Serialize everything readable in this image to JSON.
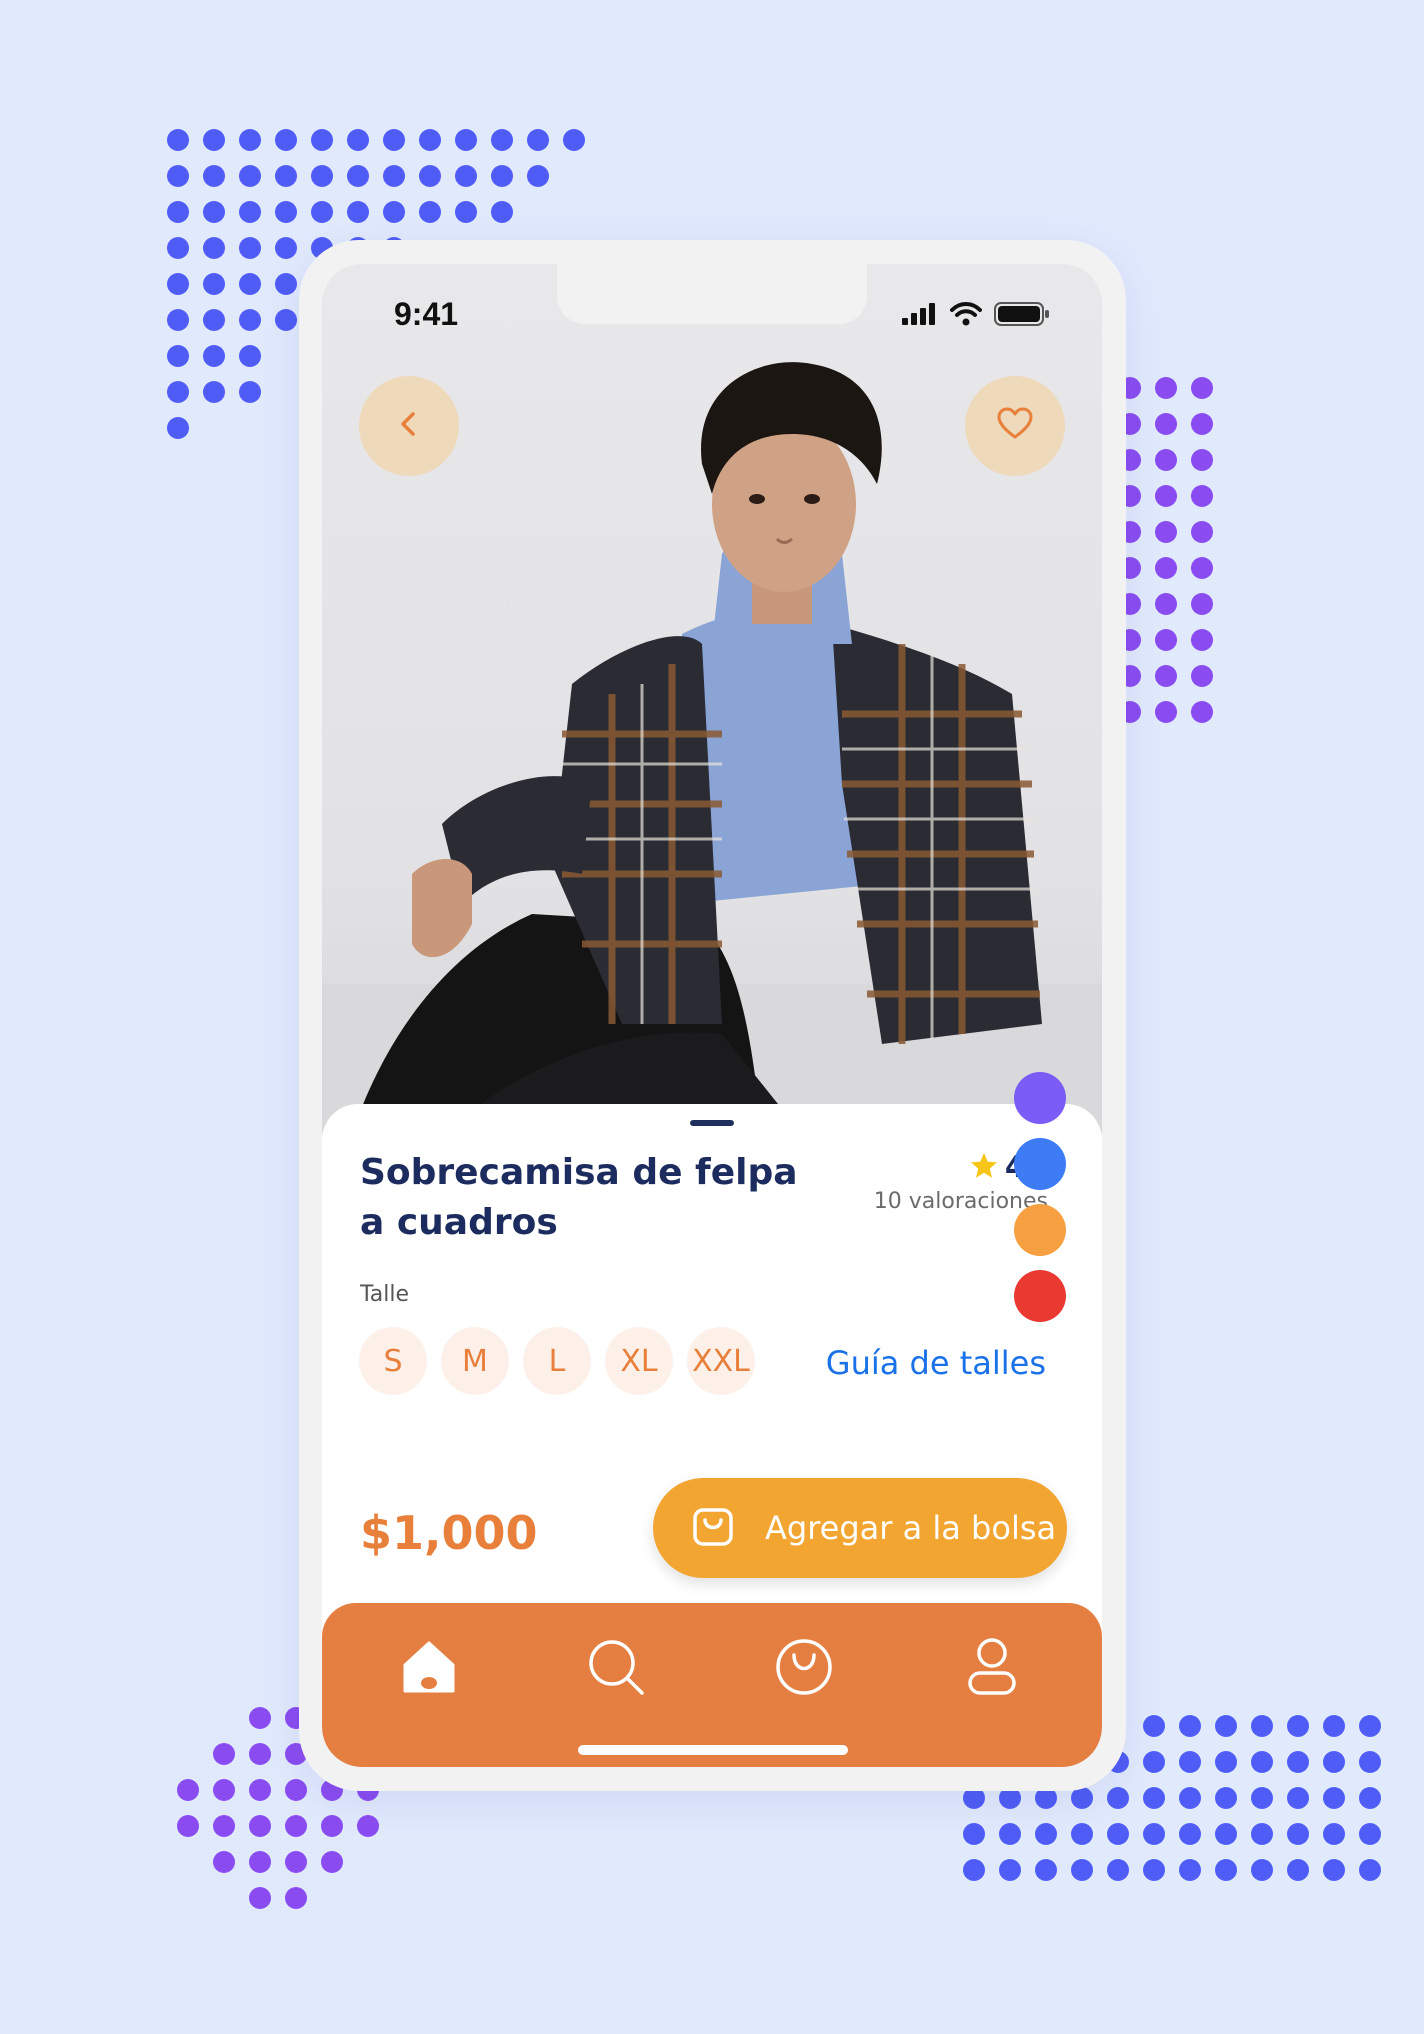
{
  "status_bar": {
    "time": "9:41",
    "signal_icon": "cellular-signal-icon",
    "wifi_icon": "wifi-icon",
    "battery_icon": "battery-icon"
  },
  "header": {
    "back_icon": "chevron-left-icon",
    "favorite_icon": "heart-icon"
  },
  "color_swatches": [
    {
      "name": "purple",
      "color": "#7b5cf6"
    },
    {
      "name": "blue",
      "color": "#3d7cf5"
    },
    {
      "name": "orange",
      "color": "#f7a041"
    },
    {
      "name": "red",
      "color": "#e83a30"
    }
  ],
  "product": {
    "title": "Sobrecamisa de felpa a cuadros",
    "rating": "4.5",
    "rating_icon": "star-icon",
    "rating_count": "10 valoraciones",
    "size_label": "Talle",
    "sizes": [
      "S",
      "M",
      "L",
      "XL",
      "XXL"
    ],
    "size_guide": "Guía de talles",
    "price": "$1,000"
  },
  "cart_button": {
    "label": "Agregar a la bolsa",
    "icon": "shopping-bag-icon"
  },
  "tabbar": {
    "items": [
      {
        "icon": "home-icon"
      },
      {
        "icon": "search-icon"
      },
      {
        "icon": "bag-icon"
      },
      {
        "icon": "profile-icon"
      }
    ]
  },
  "colors": {
    "background": "#e1e9fd",
    "accent_orange": "#e57e41",
    "button_yellow": "#f3a531",
    "title_navy": "#1d2c5e",
    "link_blue": "#1b72e8"
  }
}
